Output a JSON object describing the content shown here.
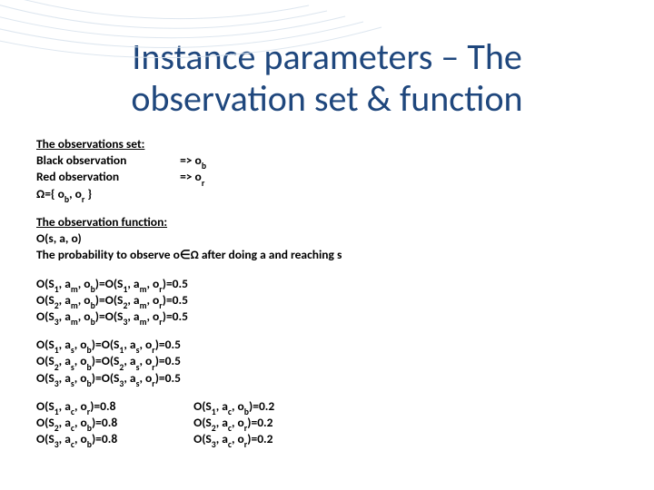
{
  "title": "Instance parameters – The observation set & function",
  "obs_set": {
    "heading": "The observations set:",
    "black_label": "Black observation",
    "black_sym": "=> o_b",
    "red_label": "Red observation",
    "red_sym": "=> o_r",
    "omega": "Ω={ o_b, o_r }"
  },
  "obs_fun": {
    "heading": "The observation function:",
    "sig": "O(s, a, o)",
    "desc": "The probability to observe o∈Ω after doing a and reaching s"
  },
  "eq_am": [
    "O(S_1, a_m, o_b)=O(S_1, a_m, o_r)=0.5",
    "O(S_2, a_m, o_b)=O(S_2, a_m, o_r)=0.5",
    "O(S_3, a_m, o_b)=O(S_3, a_m, o_r)=0.5"
  ],
  "eq_as": [
    "O(S_1, a_s, o_b)=O(S_1, a_s, o_r)=0.5",
    "O(S_2, a_s, o_b)=O(S_2, a_s, o_r)=0.5",
    "O(S_3, a_s, o_b)=O(S_3, a_s, o_r)=0.5"
  ],
  "eq_ac_left": [
    "O(S_1, a_c, o_r)=0.8",
    "O(S_2, a_c, o_b)=0.8",
    "O(S_3, a_c, o_b)=0.8"
  ],
  "eq_ac_right": [
    "O(S_1, a_c, o_b)=0.2",
    "O(S_2, a_c, o_r)=0.2",
    "O(S_3, a_c, o_r)=0.2"
  ]
}
